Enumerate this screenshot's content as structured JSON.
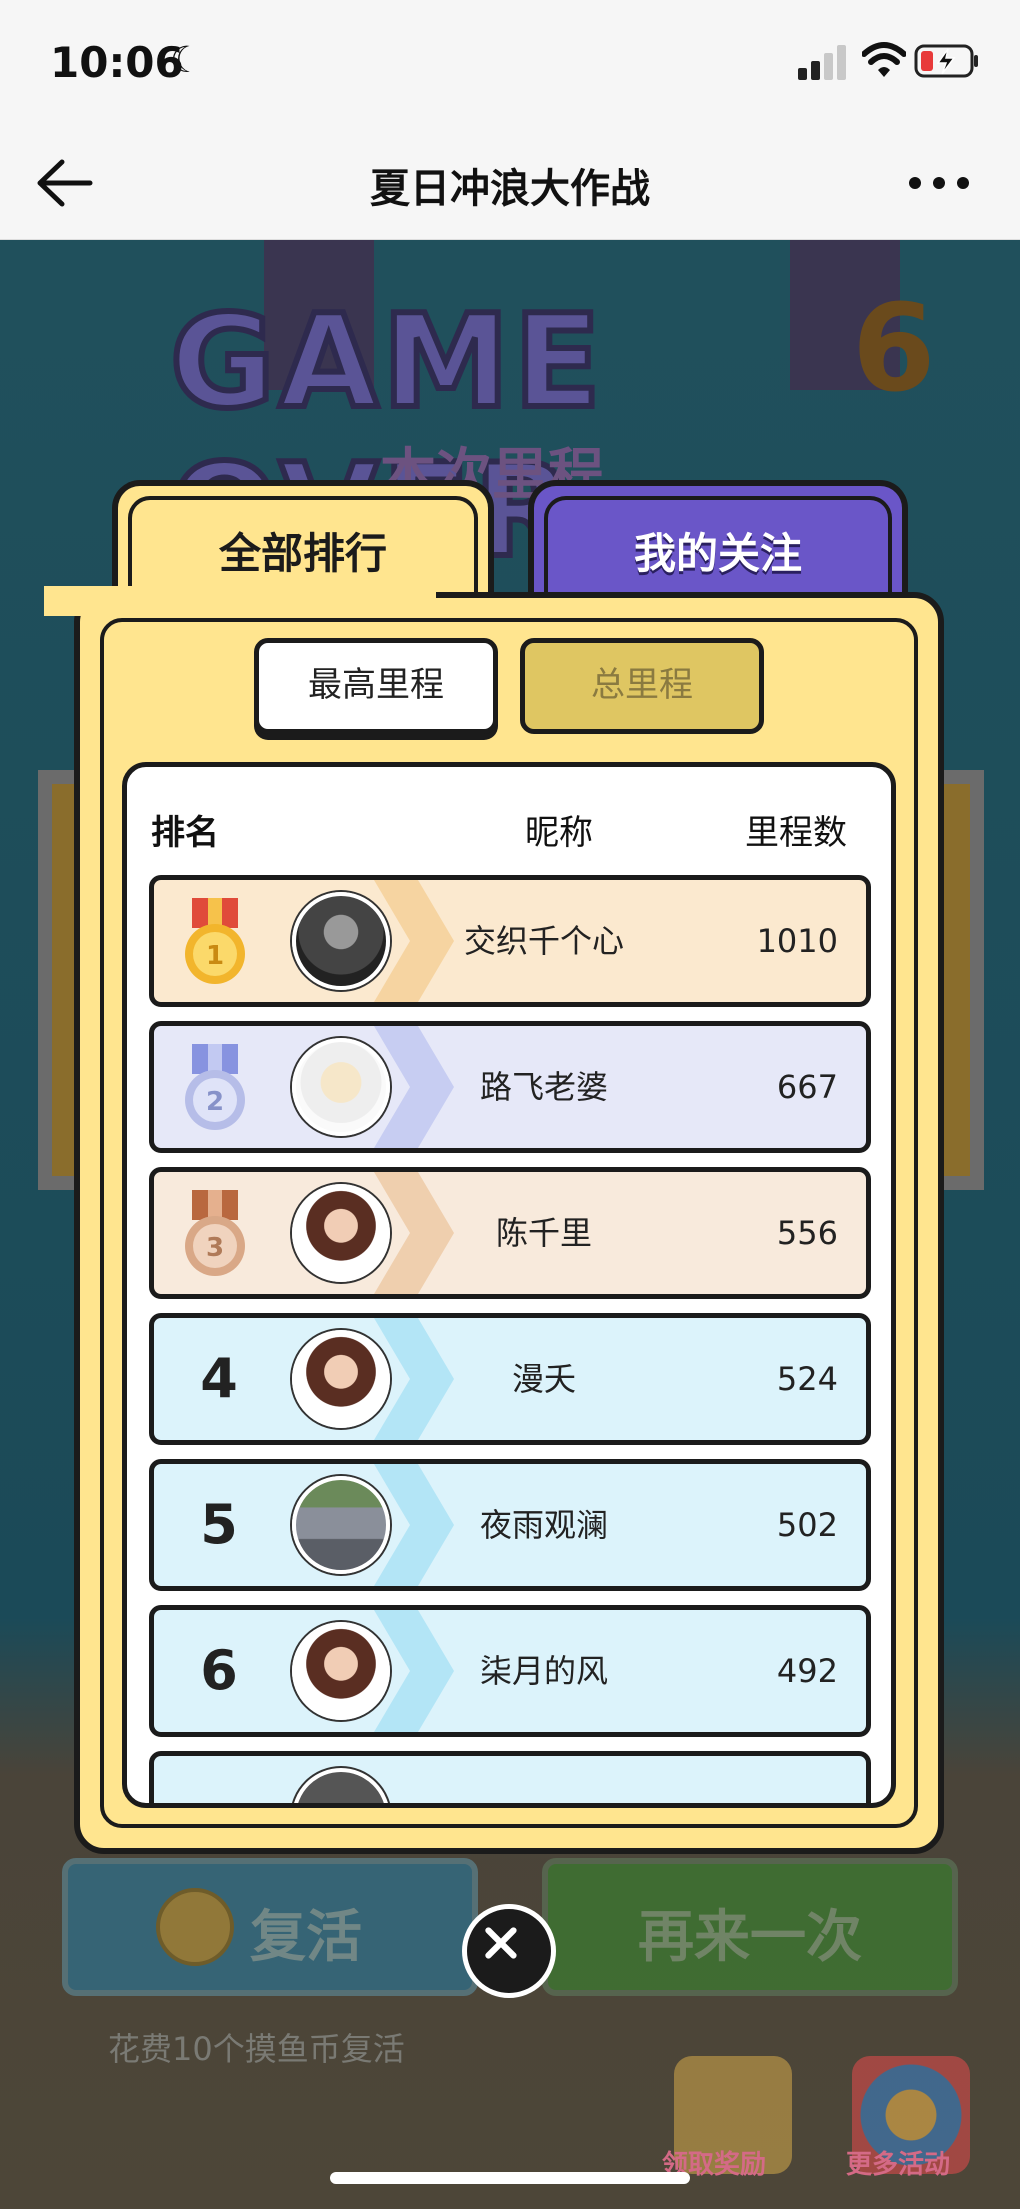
{
  "status_bar": {
    "time": "10:06",
    "moon_icon": "moon-icon",
    "signal_icon": "cellular-signal-icon",
    "wifi_icon": "wifi-icon",
    "battery_icon": "battery-low-icon"
  },
  "nav": {
    "title": "夏日冲浪大作战",
    "back_icon": "back-arrow-icon",
    "more_icon": "more-dots-icon"
  },
  "background": {
    "game_over": "GAME OVER",
    "score_digit": "6",
    "mileage_label": "本次里程"
  },
  "tabs": [
    {
      "label": "全部排行",
      "active": true
    },
    {
      "label": "我的关注",
      "active": false
    }
  ],
  "subtabs": [
    {
      "label": "最高里程",
      "active": true
    },
    {
      "label": "总里程",
      "active": false
    }
  ],
  "columns": {
    "rank": "排名",
    "nickname": "昵称",
    "distance": "里程数"
  },
  "rows": [
    {
      "rank": "1",
      "medal": "gold-medal-icon",
      "nickname": "交织千个心",
      "distance": "1010",
      "bg": "#fbe9cf",
      "chev": "#f6d4a1"
    },
    {
      "rank": "2",
      "medal": "silver-medal-icon",
      "nickname": "路飞老婆",
      "distance": "667",
      "bg": "#e6e8f8",
      "chev": "#c7cdf2"
    },
    {
      "rank": "3",
      "medal": "bronze-medal-icon",
      "nickname": "陈千里",
      "distance": "556",
      "bg": "#f8eadc",
      "chev": "#efcfae"
    },
    {
      "rank": "4",
      "nickname": "漫夭",
      "distance": "524",
      "bg": "#dcf3fb",
      "chev": "#b3e5f6"
    },
    {
      "rank": "5",
      "nickname": "夜雨观澜",
      "distance": "502",
      "bg": "#dcf3fb",
      "chev": "#b3e5f6"
    },
    {
      "rank": "6",
      "nickname": "柒月的风",
      "distance": "492",
      "bg": "#dcf3fb",
      "chev": "#b3e5f6"
    }
  ],
  "buttons": {
    "revive": "复活",
    "retry": "再来一次",
    "close_icon": "close-x-icon",
    "coin_icon": "fish-coin-icon"
  },
  "hint": "花费10个摸鱼币复活",
  "corner": {
    "rewards": "领取奖励",
    "more": "更多活动",
    "rewards_icon": "treasure-chest-icon",
    "more_icon": "beach-ball-icon"
  }
}
